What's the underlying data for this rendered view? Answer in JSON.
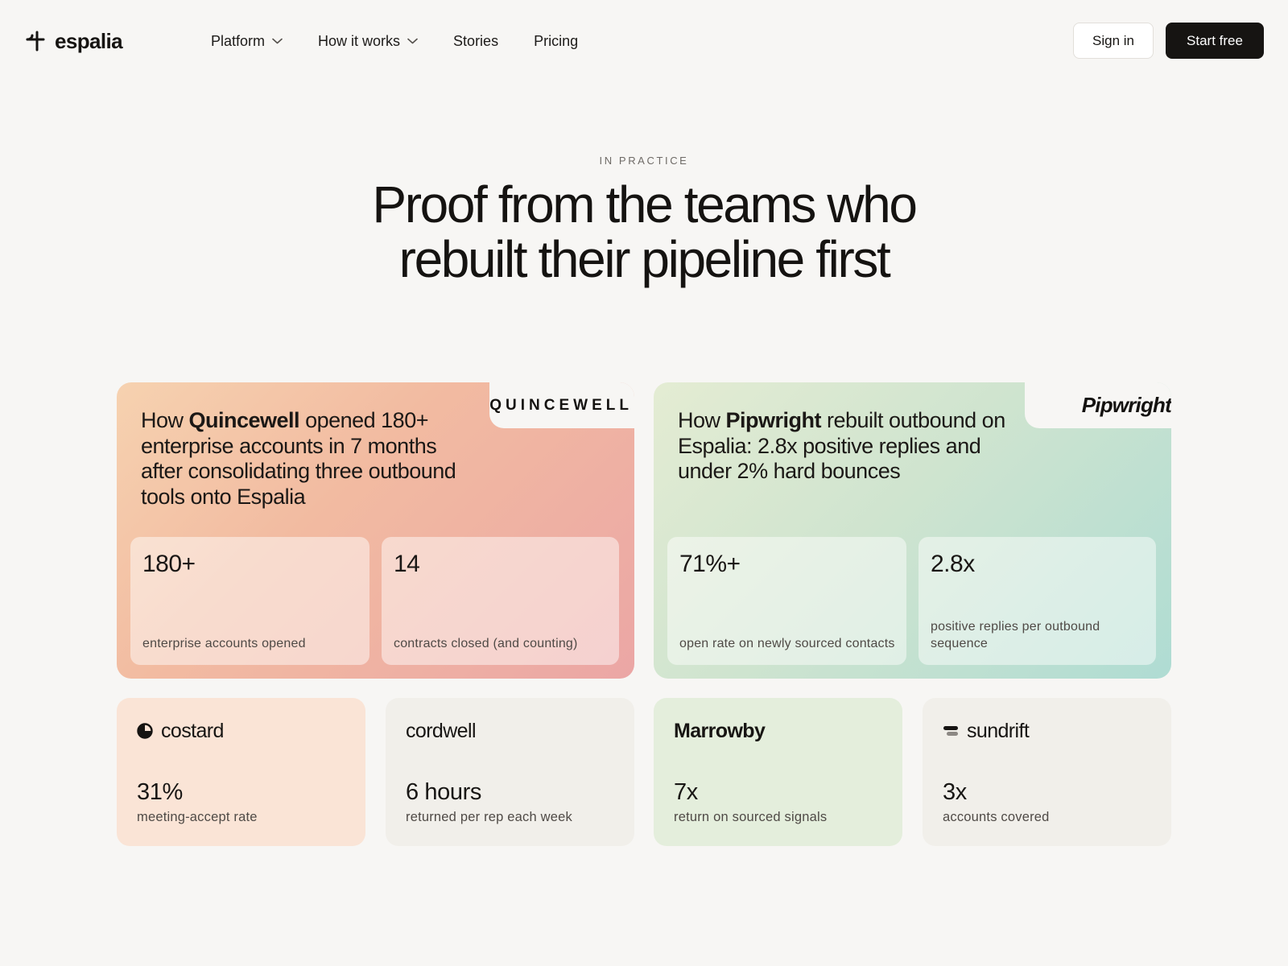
{
  "nav": {
    "logo_text": "espalia",
    "menu": [
      {
        "label": "Platform",
        "has_dropdown": true
      },
      {
        "label": "How it works",
        "has_dropdown": true
      },
      {
        "label": "Stories",
        "has_dropdown": false
      },
      {
        "label": "Pricing",
        "has_dropdown": false
      }
    ],
    "sign_in": "Sign in",
    "start_free": "Start free"
  },
  "hero": {
    "eyebrow": "IN PRACTICE",
    "title_line1": "Proof from the teams who",
    "title_line2": "rebuilt their pipeline first"
  },
  "stories": [
    {
      "brand": "QUINCEWELL",
      "title_pre": "How ",
      "title_bold": "Quincewell",
      "title_post": " opened 180+ enterprise accounts in 7 months after consolidating three outbound tools onto Espalia",
      "stats": [
        {
          "value": "180+",
          "label": "enterprise accounts opened"
        },
        {
          "value": "14",
          "label": "contracts closed (and counting)"
        }
      ]
    },
    {
      "brand": "Pipwright",
      "title_pre": "How ",
      "title_bold": "Pipwright",
      "title_post": " rebuilt outbound on Espalia: 2.8x positive replies and under 2% hard bounces",
      "stats": [
        {
          "value": "71%+",
          "label": "open rate on newly sourced contacts"
        },
        {
          "value": "2.8x",
          "label": "positive replies per outbound sequence"
        }
      ]
    }
  ],
  "customers": [
    {
      "brand": "costard",
      "icon": "half-moon-icon",
      "value": "31%",
      "label": "meeting-accept rate"
    },
    {
      "brand": "cordwell",
      "icon": "",
      "value": "6 hours",
      "label": "returned per rep each week"
    },
    {
      "brand": "Marrowby",
      "icon": "",
      "value": "7x",
      "label": "return on sourced signals"
    },
    {
      "brand": "sundrift",
      "icon": "stacked-bars-icon",
      "value": "3x",
      "label": "accounts covered"
    }
  ],
  "colors": {
    "page_bg": "#f7f6f4",
    "primary_button": "#161412",
    "story_quincewell_gradient": [
      "#f6d2b0",
      "#eba6a5"
    ],
    "story_pipwright_gradient": [
      "#e4ecd3",
      "#afdcd3"
    ],
    "costard_bg": "#fae4d6",
    "marrowby_bg": "#e4eedc",
    "neutral_card_bg": "#f1efea"
  }
}
